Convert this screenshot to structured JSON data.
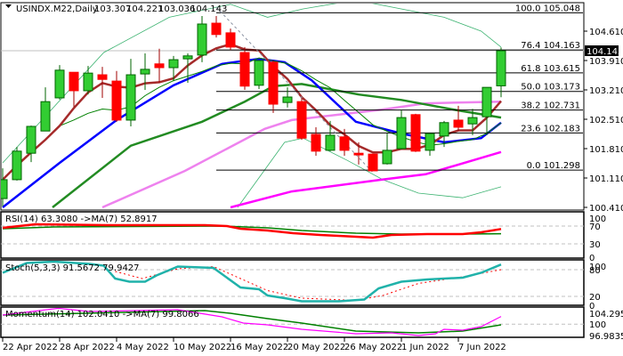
{
  "header": {
    "symbol": "USINDX.M22,Daily",
    "open": "103.307",
    "high": "104.221",
    "low": "103.036",
    "close": "104.143"
  },
  "current_price_label": "104.143",
  "colors": {
    "bull": "#32cd32",
    "bear": "#ff0000",
    "ma5": "#a52a2a",
    "ma10": "#008000",
    "ma20": "#0000ff",
    "ma_dark": "#228b22",
    "ma_violet": "#ee82ee",
    "ma_magenta": "#ff00ff",
    "bands": "#3cb371",
    "rsi": "#ff0000",
    "rsi_ma": "#008000",
    "stoch": "#20b2aa",
    "stoch_signal": "#ff0000",
    "mom": "#ff00ff",
    "mom_ma": "#008000"
  },
  "chart_data": [
    {
      "type": "candlestick",
      "title": "USINDX.M22,Daily",
      "y_axis_ticks": [
        "104.610",
        "103.910",
        "103.210",
        "102.510",
        "101.810",
        "101.110",
        "100.410"
      ],
      "ylim": [
        100.41,
        104.61
      ],
      "x_axis_ticks": [
        {
          "index": 0,
          "label": "22 Apr 2022"
        },
        {
          "index": 4,
          "label": "28 Apr 2022"
        },
        {
          "index": 8,
          "label": "4 May 2022"
        },
        {
          "index": 12,
          "label": "10 May 2022"
        },
        {
          "index": 16,
          "label": "16 May 2022"
        },
        {
          "index": 20,
          "label": "20 May 2022"
        },
        {
          "index": 24,
          "label": "26 May 2022"
        },
        {
          "index": 28,
          "label": "1 Jun 2022"
        },
        {
          "index": 32,
          "label": "7 Jun 2022"
        }
      ],
      "ohlc": [
        [
          100.62,
          101.34,
          100.43,
          101.07
        ],
        [
          101.07,
          101.85,
          101.05,
          101.75
        ],
        [
          101.7,
          102.36,
          101.49,
          102.34
        ],
        [
          102.23,
          103.27,
          102.23,
          102.93
        ],
        [
          103.02,
          103.8,
          102.98,
          103.68
        ],
        [
          103.63,
          103.63,
          102.81,
          103.19
        ],
        [
          103.19,
          103.78,
          103.1,
          103.61
        ],
        [
          103.57,
          103.76,
          103.02,
          103.46
        ],
        [
          103.42,
          103.66,
          102.45,
          102.49
        ],
        [
          102.49,
          103.95,
          102.34,
          103.57
        ],
        [
          103.59,
          104.08,
          103.21,
          103.7
        ],
        [
          103.83,
          104.19,
          103.38,
          103.74
        ],
        [
          103.74,
          104.02,
          103.42,
          103.93
        ],
        [
          103.95,
          104.08,
          103.38,
          104.02
        ],
        [
          104.04,
          104.97,
          103.87,
          104.78
        ],
        [
          104.8,
          104.97,
          104.46,
          104.53
        ],
        [
          104.57,
          104.67,
          104.16,
          104.23
        ],
        [
          104.1,
          104.23,
          103.21,
          103.3
        ],
        [
          103.32,
          103.91,
          103.23,
          103.91
        ],
        [
          103.87,
          103.91,
          102.66,
          102.87
        ],
        [
          102.91,
          103.27,
          102.79,
          103.04
        ],
        [
          102.93,
          103.02,
          102.02,
          102.06
        ],
        [
          102.15,
          102.32,
          101.64,
          101.75
        ],
        [
          101.77,
          102.47,
          101.75,
          102.13
        ],
        [
          102.09,
          102.28,
          101.64,
          101.77
        ],
        [
          101.7,
          101.96,
          101.43,
          101.66
        ],
        [
          101.68,
          101.68,
          101.28,
          101.28
        ],
        [
          101.45,
          102.17,
          101.43,
          101.77
        ],
        [
          101.81,
          102.72,
          101.79,
          102.55
        ],
        [
          102.62,
          102.64,
          101.73,
          101.75
        ],
        [
          101.77,
          102.17,
          101.64,
          102.17
        ],
        [
          102.11,
          102.47,
          101.85,
          102.43
        ],
        [
          102.49,
          102.83,
          102.23,
          102.32
        ],
        [
          102.4,
          102.76,
          102.13,
          102.55
        ],
        [
          102.57,
          103.27,
          102.13,
          103.27
        ],
        [
          103.307,
          104.221,
          103.036,
          104.143
        ]
      ],
      "ma_series": {
        "ma_dark": [
          [
            3.5,
            100.41
          ],
          [
            9,
            101.88
          ],
          [
            14,
            102.45
          ],
          [
            17,
            102.93
          ],
          [
            19,
            103.3
          ],
          [
            21,
            103.35
          ],
          [
            25,
            103.1
          ],
          [
            28,
            102.97
          ],
          [
            32,
            102.72
          ],
          [
            35,
            102.55
          ]
        ],
        "ma_violet": [
          [
            7,
            100.41
          ],
          [
            12.8,
            101.28
          ],
          [
            18.4,
            102.28
          ],
          [
            20.3,
            102.49
          ],
          [
            26.6,
            102.74
          ],
          [
            29.7,
            102.89
          ],
          [
            35,
            102.93
          ]
        ],
        "ma_magenta": [
          [
            16,
            100.41
          ],
          [
            20.3,
            100.79
          ],
          [
            26.6,
            101.07
          ],
          [
            29.7,
            101.2
          ],
          [
            35,
            101.73
          ]
        ],
        "ma20": [
          [
            0,
            100.41
          ],
          [
            4,
            101.47
          ],
          [
            8,
            102.49
          ],
          [
            12,
            103.32
          ],
          [
            15.4,
            103.83
          ],
          [
            18,
            103.95
          ],
          [
            19.8,
            103.87
          ],
          [
            21.7,
            103.44
          ],
          [
            24.8,
            102.45
          ],
          [
            28,
            102.17
          ],
          [
            31,
            101.96
          ],
          [
            33.6,
            102.06
          ],
          [
            35,
            102.43
          ]
        ],
        "band_upper": [
          [
            0,
            101.47
          ],
          [
            7.1,
            104.1
          ],
          [
            11.7,
            104.94
          ],
          [
            16,
            105.25
          ],
          [
            18.6,
            104.94
          ],
          [
            21.1,
            105.14
          ],
          [
            24.8,
            105.35
          ],
          [
            31,
            104.94
          ],
          [
            33.6,
            104.61
          ],
          [
            35,
            104.23
          ]
        ],
        "band_lower": [
          [
            16.5,
            100.41
          ],
          [
            19.8,
            101.96
          ],
          [
            21.1,
            102.06
          ],
          [
            24.2,
            101.53
          ],
          [
            26.7,
            101.07
          ],
          [
            29.2,
            100.75
          ],
          [
            32.3,
            100.64
          ],
          [
            35,
            100.9
          ]
        ]
      },
      "fibonacci": [
        {
          "label": "100.0 105.048",
          "price": 105.048
        },
        {
          "label": "76.4 104.163",
          "price": 104.163
        },
        {
          "label": "61.8 103.615",
          "price": 103.615
        },
        {
          "label": "50.0 103.173",
          "price": 103.173
        },
        {
          "label": "38.2 102.731",
          "price": 102.731
        },
        {
          "label": "23.6 102.183",
          "price": 102.183
        },
        {
          "label": "0.0 101.298",
          "price": 101.298
        }
      ]
    },
    {
      "type": "line",
      "title": "RSI(14) 63.3080 ->MA(7) 52.8917",
      "ylim": [
        0,
        100
      ],
      "y_axis_ticks": [
        "100",
        "70",
        "30",
        "0"
      ],
      "levels": [
        70,
        30
      ],
      "series": [
        {
          "name": "RSI(14)",
          "points": [
            [
              0,
              66
            ],
            [
              2.3,
              74
            ],
            [
              7.3,
              72
            ],
            [
              14.2,
              72
            ],
            [
              15.75,
              70
            ],
            [
              16.7,
              64
            ],
            [
              18.6,
              60
            ],
            [
              20.4,
              54
            ],
            [
              22.3,
              50
            ],
            [
              23.6,
              48
            ],
            [
              26,
              44
            ],
            [
              27.3,
              50
            ],
            [
              29.8,
              52
            ],
            [
              32.3,
              52
            ],
            [
              33.6,
              56
            ],
            [
              35,
              63.31
            ]
          ]
        },
        {
          "name": "MA(7)",
          "points": [
            [
              0,
              64
            ],
            [
              3.6,
              68
            ],
            [
              15.4,
              70
            ],
            [
              18.6,
              66
            ],
            [
              21,
              60
            ],
            [
              24.8,
              54
            ],
            [
              28,
              52
            ],
            [
              32.3,
              52
            ],
            [
              35,
              52.89
            ]
          ]
        }
      ]
    },
    {
      "type": "line",
      "title": "Stoch(5,3,3) 91.5672 79.9427",
      "ylim": [
        0,
        100
      ],
      "y_axis_ticks": [
        "100",
        "80",
        "20",
        "0"
      ],
      "levels": [
        80,
        20
      ],
      "series": [
        {
          "name": "Main",
          "points": [
            [
              0,
              73
            ],
            [
              1.7,
              95
            ],
            [
              3.6,
              98
            ],
            [
              6.1,
              93
            ],
            [
              7.1,
              89
            ],
            [
              7.9,
              60
            ],
            [
              8.9,
              53
            ],
            [
              10,
              53
            ],
            [
              10.8,
              67
            ],
            [
              12.3,
              87
            ],
            [
              14.8,
              84
            ],
            [
              16.7,
              40
            ],
            [
              18,
              36
            ],
            [
              18.6,
              22
            ],
            [
              19.8,
              16
            ],
            [
              21,
              9
            ],
            [
              23.6,
              9
            ],
            [
              25.4,
              13
            ],
            [
              26.4,
              38
            ],
            [
              28,
              53
            ],
            [
              29.8,
              58
            ],
            [
              32.3,
              62
            ],
            [
              33.6,
              73
            ],
            [
              35,
              91.57
            ]
          ]
        },
        {
          "name": "Signal",
          "points": [
            [
              7.9,
              76
            ],
            [
              9.8,
              60
            ],
            [
              12.3,
              82
            ],
            [
              14.8,
              87
            ],
            [
              16.7,
              60
            ],
            [
              18.6,
              33
            ],
            [
              21,
              16
            ],
            [
              24.8,
              11
            ],
            [
              26.7,
              22
            ],
            [
              29.2,
              49
            ],
            [
              32.3,
              64
            ],
            [
              35,
              79.94
            ]
          ]
        }
      ]
    },
    {
      "type": "line",
      "title": "Momentum(14) 102.0410 ->MA(7) 99.8066",
      "ylim": [
        96.9835,
        104.295
      ],
      "y_axis_ticks": [
        "104.295",
        "100",
        "96.9835"
      ],
      "levels": [
        100
      ],
      "series": [
        {
          "name": "Momentum(14)",
          "points": [
            [
              0,
              102.41
            ],
            [
              3.9,
              104.2
            ],
            [
              6.1,
              103.35
            ],
            [
              12.3,
              103.82
            ],
            [
              15.4,
              101.94
            ],
            [
              16.9,
              100.29
            ],
            [
              18.6,
              99.82
            ],
            [
              21,
              98.63
            ],
            [
              24.8,
              97.46
            ],
            [
              27.3,
              97.69
            ],
            [
              29.2,
              96.98
            ],
            [
              30.4,
              97.46
            ],
            [
              31,
              98.63
            ],
            [
              32.3,
              98.4
            ],
            [
              33.6,
              99.35
            ],
            [
              35,
              102.04
            ]
          ]
        },
        {
          "name": "MA(7)",
          "points": [
            [
              0,
              102.41
            ],
            [
              14.2,
              103.59
            ],
            [
              16,
              102.88
            ],
            [
              18.6,
              101.47
            ],
            [
              21,
              100.29
            ],
            [
              24.8,
              98.16
            ],
            [
              29.2,
              97.69
            ],
            [
              32.3,
              98.16
            ],
            [
              35,
              99.81
            ]
          ]
        }
      ]
    }
  ]
}
